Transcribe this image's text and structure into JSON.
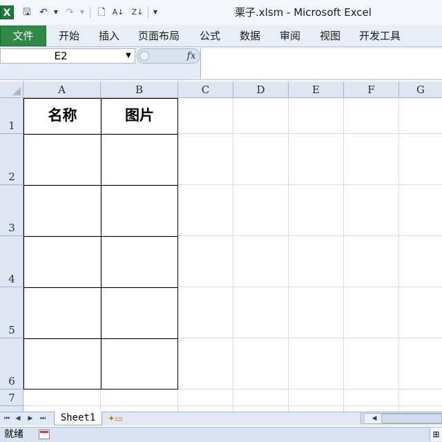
{
  "window": {
    "title": "栗子.xlsm - Microsoft Excel",
    "app_icon_glyph": "X"
  },
  "quick_access": [
    {
      "name": "save-icon",
      "glyph": "🖫"
    },
    {
      "name": "undo-icon",
      "glyph": "↶"
    },
    {
      "name": "redo-icon",
      "glyph": "↷"
    },
    {
      "name": "new-document-icon",
      "glyph": "🗋"
    },
    {
      "name": "sort-ascending-icon",
      "glyph": "A↓"
    },
    {
      "name": "sort-descending-icon",
      "glyph": "Z↓"
    }
  ],
  "ribbon": {
    "file_tab": "文件",
    "tabs": [
      "开始",
      "插入",
      "页面布局",
      "公式",
      "数据",
      "审阅",
      "视图",
      "开发工具"
    ]
  },
  "formula_bar": {
    "name_box": "E2",
    "fx_label": "fx",
    "formula": ""
  },
  "sheet": {
    "columns": [
      "A",
      "B",
      "C",
      "D",
      "E",
      "F",
      "G"
    ],
    "rows": [
      "1",
      "2",
      "3",
      "4",
      "5",
      "6",
      "7"
    ],
    "cells": {
      "A1": "名称",
      "B1": "图片"
    }
  },
  "sheet_tabs": {
    "active": "Sheet1",
    "nav_glyphs": [
      "⏮",
      "◀",
      "▶",
      "⏭"
    ]
  },
  "status_bar": {
    "status": "就绪"
  },
  "colors": {
    "file_tab_green": "#2f8a45",
    "header_bg": "#dfe6f1",
    "gridline": "#dadcdd"
  }
}
